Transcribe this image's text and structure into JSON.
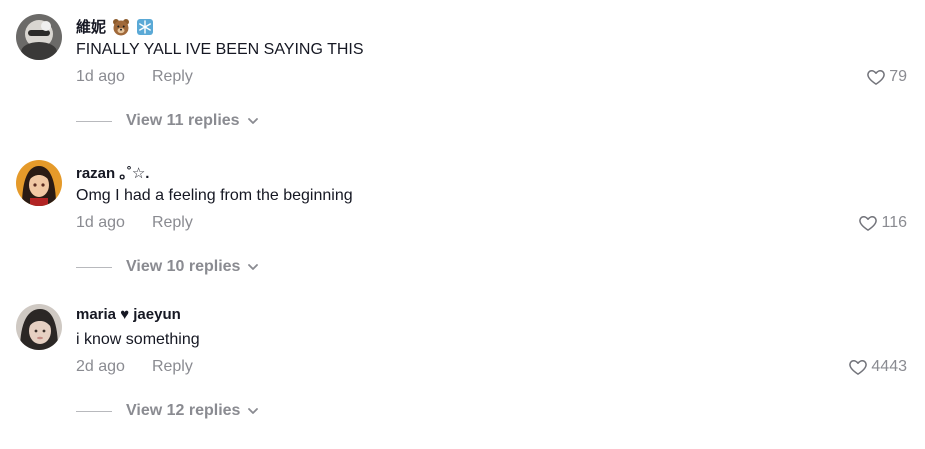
{
  "comments": [
    {
      "username": "維妮",
      "username_emojis": [
        "bear-emoji",
        "snowflake-emoji"
      ],
      "text": "FINALLY YALL IVE BEEN SAYING THIS",
      "time": "1d ago",
      "reply_label": "Reply",
      "likes": "79",
      "view_replies": "View 11 replies"
    },
    {
      "username": "razan ｡˚☆.",
      "text": "Omg I had a feeling from the beginning",
      "time": "1d ago",
      "reply_label": "Reply",
      "likes": "116",
      "view_replies": "View 10 replies"
    },
    {
      "username": "maria ♥ jaeyun",
      "text": "i know something",
      "time": "2d ago",
      "reply_label": "Reply",
      "likes": "4443",
      "view_replies": "View 12 replies"
    }
  ],
  "colors": {
    "text_primary": "#161823",
    "text_secondary": "#8a8b91"
  },
  "icons": {
    "like": "heart-outline-icon",
    "expand": "chevron-down-icon"
  }
}
